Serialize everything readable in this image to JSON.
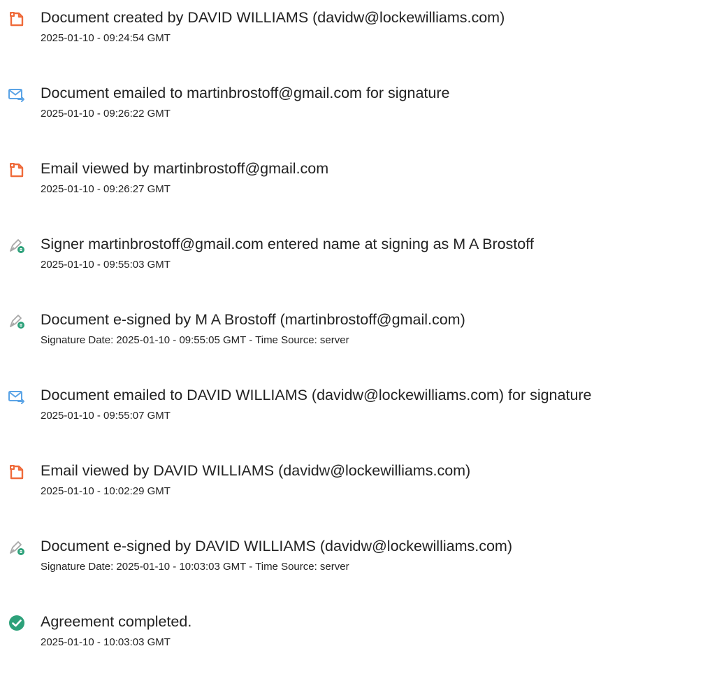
{
  "events": [
    {
      "icon": "document-created-icon",
      "title": "Document created by DAVID WILLIAMS (davidw@lockewilliams.com)",
      "time": "2025-01-10 - 09:24:54 GMT"
    },
    {
      "icon": "email-sent-icon",
      "title": "Document emailed to martinbrostoff@gmail.com for signature",
      "time": "2025-01-10 - 09:26:22 GMT"
    },
    {
      "icon": "email-viewed-icon",
      "title": "Email viewed by martinbrostoff@gmail.com",
      "time": "2025-01-10 - 09:26:27 GMT"
    },
    {
      "icon": "signer-pen-icon",
      "title": "Signer martinbrostoff@gmail.com entered name at signing as M A Brostoff",
      "time": "2025-01-10 - 09:55:03 GMT"
    },
    {
      "icon": "esigned-pen-icon",
      "title": "Document e-signed by M A Brostoff (martinbrostoff@gmail.com)",
      "time": "Signature Date: 2025-01-10 - 09:55:05 GMT - Time Source: server"
    },
    {
      "icon": "email-sent-icon",
      "title": "Document emailed to DAVID WILLIAMS (davidw@lockewilliams.com) for signature",
      "time": "2025-01-10 - 09:55:07 GMT"
    },
    {
      "icon": "email-viewed-icon",
      "title": "Email viewed by DAVID WILLIAMS (davidw@lockewilliams.com)",
      "time": "2025-01-10 - 10:02:29 GMT"
    },
    {
      "icon": "esigned-pen-icon",
      "title": "Document e-signed by DAVID WILLIAMS (davidw@lockewilliams.com)",
      "time": "Signature Date: 2025-01-10 - 10:03:03 GMT - Time Source: server"
    },
    {
      "icon": "completed-check-icon",
      "title": "Agreement completed.",
      "time": "2025-01-10 - 10:03:03 GMT"
    }
  ],
  "colors": {
    "document_orange": "#EF6B3B",
    "email_blue": "#5BA4E6",
    "pen_green": "#2DA17A",
    "pen_gray": "#A8A8A8",
    "check_green": "#2DA17A",
    "text": "#222222"
  }
}
